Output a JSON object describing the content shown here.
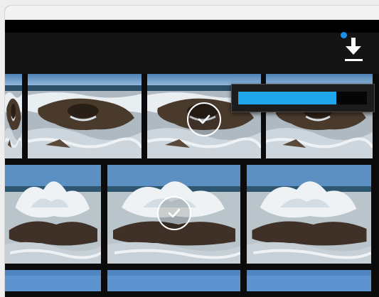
{
  "toolbar": {
    "download_icon": "download-icon",
    "has_notification": true
  },
  "download": {
    "progress": 0.76,
    "fill_color": "#1ea5ea"
  },
  "photos": [
    {
      "id": "r1c0",
      "selected": false,
      "scene": "blowhole"
    },
    {
      "id": "r1c1",
      "selected": false,
      "scene": "blowhole"
    },
    {
      "id": "r1c2",
      "selected": true,
      "scene": "blowhole"
    },
    {
      "id": "r1c3",
      "selected": false,
      "scene": "blowhole"
    },
    {
      "id": "r2c0",
      "selected": false,
      "scene": "wave"
    },
    {
      "id": "r2c1",
      "selected": true,
      "scene": "wave"
    },
    {
      "id": "r2c2",
      "selected": false,
      "scene": "wave"
    },
    {
      "id": "r3c0",
      "selected": false,
      "scene": "sky"
    },
    {
      "id": "r3c1",
      "selected": false,
      "scene": "sky"
    },
    {
      "id": "r3c2",
      "selected": false,
      "scene": "sky"
    }
  ]
}
